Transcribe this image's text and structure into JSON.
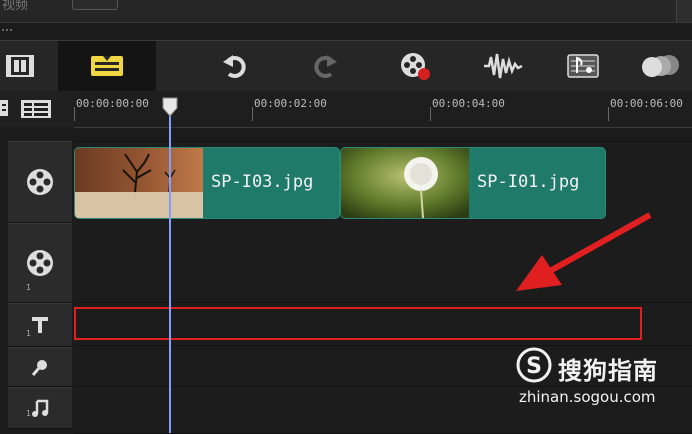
{
  "top_panel": {
    "label": "视频"
  },
  "toolbar": {
    "buttons": [
      {
        "name": "storyboard-view-button",
        "icon": "filmstrip-icon"
      },
      {
        "name": "timeline-view-button",
        "icon": "timeline-icon",
        "active": true
      },
      {
        "name": "undo-button",
        "icon": "undo-icon"
      },
      {
        "name": "redo-button",
        "icon": "redo-icon"
      },
      {
        "name": "record-capture-button",
        "icon": "record-icon"
      },
      {
        "name": "sound-mixer-button",
        "icon": "audio-wave-icon"
      },
      {
        "name": "auto-music-button",
        "icon": "music-score-icon"
      },
      {
        "name": "multi-overlay-button",
        "icon": "overlay-circles-icon"
      }
    ]
  },
  "timeline": {
    "zoom_control": "+/−",
    "ruler_ticks": [
      "00:00:00:00",
      "00:00:02:00",
      "00:00:04:00",
      "00:00:06:00"
    ],
    "playhead": "00:00:00:00",
    "tracks": [
      {
        "name": "video-track",
        "icon": "film-reel-icon",
        "number": ""
      },
      {
        "name": "overlay-track",
        "icon": "film-reel-icon",
        "number": "1"
      },
      {
        "name": "title-track",
        "icon": "title-text-icon",
        "number": "1"
      },
      {
        "name": "voice-track",
        "icon": "microphone-icon",
        "number": ""
      },
      {
        "name": "music-track",
        "icon": "music-note-icon",
        "number": "1"
      }
    ],
    "clips": [
      {
        "label": "SP-I03.jpg",
        "thumb": "desert-tree-thumbnail"
      },
      {
        "label": "SP-I01.jpg",
        "thumb": "dandelion-thumbnail"
      }
    ]
  },
  "colors": {
    "clip": "#1f7a6a",
    "playhead": "#7fa0ff",
    "highlight": "#e02020",
    "active_button_icon": "#f0d640"
  },
  "watermark": {
    "brand": "搜狗指南",
    "url": "zhinan.sogou.com"
  }
}
